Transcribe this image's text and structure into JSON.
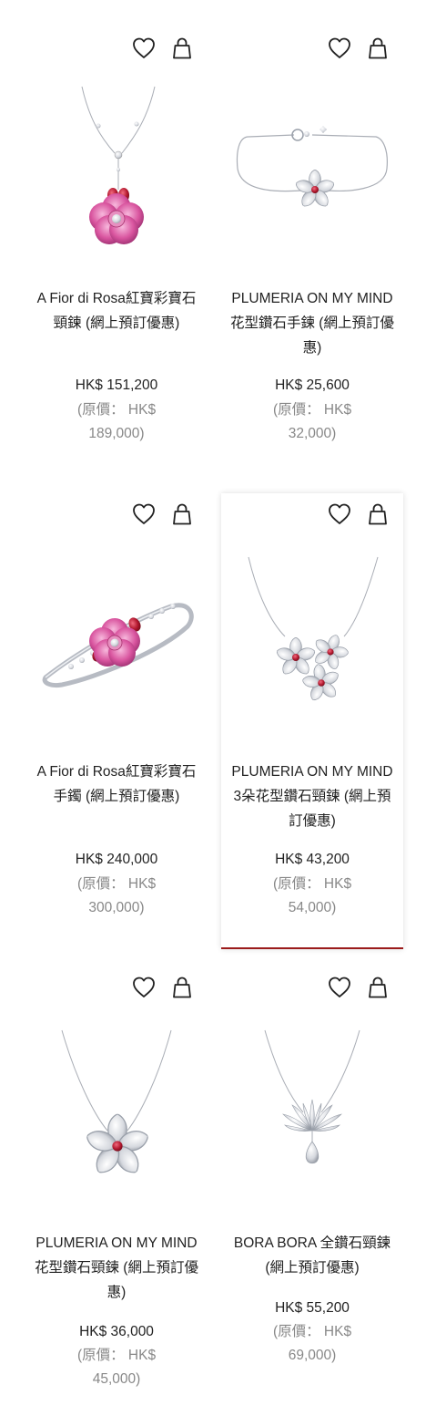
{
  "colors": {
    "accent": "#9b1b1b",
    "text": "#222222",
    "muted": "#888888",
    "ruby": "#b3182f",
    "pink": "#d9559f"
  },
  "products": [
    {
      "name": "A Fior di Rosa紅寶彩寶石頸鍊 (網上預訂優惠)",
      "price": "HK$ 151,200",
      "original_price": "(原價： HK$ 189,000)",
      "image": "rose-ruby-pendant-necklace",
      "wishlist_icon": "heart-icon",
      "cart_icon": "shopping-bag-icon"
    },
    {
      "name": "PLUMERIA ON MY MIND 花型鑽石手鍊 (網上預訂優惠)",
      "price": "HK$ 25,600",
      "original_price": "(原價： HK$ 32,000)",
      "image": "plumeria-diamond-bracelet",
      "wishlist_icon": "heart-icon",
      "cart_icon": "shopping-bag-icon"
    },
    {
      "name": "A Fior di Rosa紅寶彩寶石手鐲 (網上預訂優惠)",
      "price": "HK$ 240,000",
      "original_price": "(原價： HK$ 300,000)",
      "image": "rose-ruby-bangle",
      "wishlist_icon": "heart-icon",
      "cart_icon": "shopping-bag-icon"
    },
    {
      "name": "PLUMERIA ON MY MIND 3朵花型鑽石頸鍊 (網上預訂優惠)",
      "price": "HK$ 43,200",
      "original_price": "(原價： HK$ 54,000)",
      "image": "three-plumeria-diamond-necklace",
      "wishlist_icon": "heart-icon",
      "cart_icon": "shopping-bag-icon",
      "highlighted": true
    },
    {
      "name": "PLUMERIA ON MY MIND 花型鑽石頸鍊 (網上預訂優惠)",
      "price": "HK$ 36,000",
      "original_price": "(原價： HK$ 45,000)",
      "image": "plumeria-diamond-pendant-necklace",
      "wishlist_icon": "heart-icon",
      "cart_icon": "shopping-bag-icon"
    },
    {
      "name": "BORA BORA 全鑽石頸鍊 (網上預訂優惠)",
      "price": "HK$ 55,200",
      "original_price": "(原價： HK$ 69,000)",
      "image": "bora-bora-diamond-necklace",
      "wishlist_icon": "heart-icon",
      "cart_icon": "shopping-bag-icon"
    }
  ]
}
